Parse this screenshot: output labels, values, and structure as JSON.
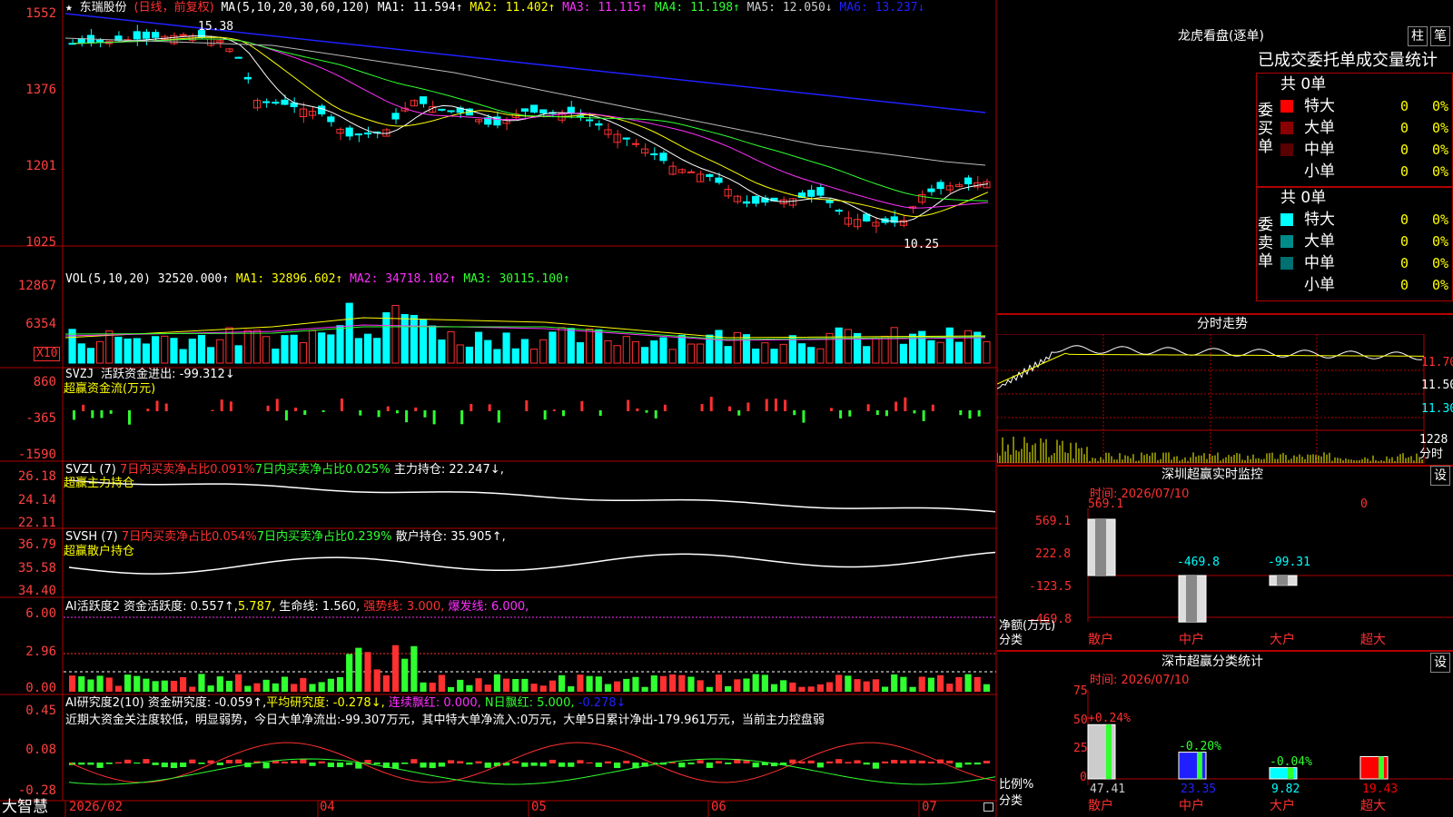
{
  "stock": {
    "star": "★",
    "name": "东瑞股份",
    "mode": "(日线，前复权)",
    "ma_label": "MA(5,10,20,30,60,120)",
    "ma_values": [
      {
        "label": "MA1:",
        "value": "11.594↑",
        "color": "#ffffff"
      },
      {
        "label": "MA2:",
        "value": "11.402↑",
        "color": "#ffff00"
      },
      {
        "label": "MA3:",
        "value": "11.115↑",
        "color": "#ff30ff"
      },
      {
        "label": "MA4:",
        "value": "11.198↑",
        "color": "#30ff30"
      },
      {
        "label": "MA5:",
        "value": "12.050↓",
        "color": "#cccccc"
      },
      {
        "label": "MA6:",
        "value": "13.237↓",
        "color": "#2020ff"
      }
    ],
    "high_marker": "15.38",
    "low_marker": "10.25",
    "price_axis": [
      "1552",
      "1376",
      "1201",
      "1025"
    ]
  },
  "vol": {
    "title": "VOL(5,10,20)",
    "value": "32520.000↑",
    "ma": [
      {
        "label": "MA1:",
        "value": "32896.602↑",
        "color": "#ffff00"
      },
      {
        "label": "MA2:",
        "value": "34718.102↑",
        "color": "#ff30ff"
      },
      {
        "label": "MA3:",
        "value": "30115.100↑",
        "color": "#30ff30"
      }
    ],
    "axis": [
      "12867",
      "6354"
    ],
    "unit": "X10"
  },
  "svzj": {
    "title": "SVZJ",
    "line": "活跃资金进出: -99.312↓",
    "sub": "超赢资金流(万元)",
    "axis": [
      "860",
      "-365",
      "-1590"
    ]
  },
  "svzl": {
    "title": "SVZL (7)",
    "t1": "7日内买卖净占比0.091%",
    "t2": "7日内买卖净占比0.025%",
    "t3": "主力持仓: 22.247↓,",
    "sub": "超赢主力持仓",
    "axis": [
      "26.18",
      "24.14",
      "22.11"
    ]
  },
  "svsh": {
    "title": "SVSH (7)",
    "t1": "7日内买卖净占比0.054%",
    "t2": "7日内买卖净占比0.239%",
    "t3": "散户持仓: 35.905↑,",
    "sub": "超赢散户持仓",
    "axis": [
      "36.79",
      "35.58",
      "34.40"
    ]
  },
  "ai1": {
    "title": "AI活跃度2",
    "t1": "资金活跃度: 0.557↑,",
    "t2": "5.787,",
    "t3": "生命线: 1.560,",
    "t4": "强势线: 3.000,",
    "t5": "爆发线: 6.000,",
    "axis": [
      "6.00",
      "2.96",
      "0.00"
    ]
  },
  "ai2": {
    "title": "AI研究度2(10)",
    "t1": "资金研究度: -0.059↑,",
    "t2": "平均研究度: -0.278↓,",
    "t3": "连续飘红: 0.000,",
    "t4": "N日飘红: 5.000,",
    "t5": "-0.278↓",
    "comment": "近期大资金关注度较低，明显弱势，今日大单净流出:-99.307万元，其中特大单净流入:0万元，大单5日累计净出-179.961万元，当前主力控盘弱",
    "axis": [
      "0.45",
      "0.08",
      "-0.28"
    ]
  },
  "dates": [
    "2026/02",
    "04",
    "05",
    "06",
    "07"
  ],
  "brand": "大智慧",
  "lhb": {
    "title": "龙虎看盘(逐单)",
    "btn1": "柱",
    "btn2": "笔",
    "stat_title": "已成交委托单成交量统计",
    "buy_label": "委买单",
    "sell_label": "委卖单",
    "buy_total": "共 0单",
    "sell_total": "共 0单",
    "buy_rows": [
      {
        "name": "特大",
        "v": "0",
        "p": "0%",
        "color": "#ff0000"
      },
      {
        "name": "大单",
        "v": "0",
        "p": "0%",
        "color": "#8b0000"
      },
      {
        "name": "中单",
        "v": "0",
        "p": "0%",
        "color": "#5a0000"
      },
      {
        "name": "小单",
        "v": "0",
        "p": "0%",
        "color": "#000000"
      }
    ],
    "sell_rows": [
      {
        "name": "特大",
        "v": "0",
        "p": "0%",
        "color": "#00ffff"
      },
      {
        "name": "大单",
        "v": "0",
        "p": "0%",
        "color": "#008b8b"
      },
      {
        "name": "中单",
        "v": "0",
        "p": "0%",
        "color": "#007070"
      },
      {
        "name": "小单",
        "v": "0",
        "p": "0%",
        "color": "#000000"
      }
    ]
  },
  "intraday": {
    "title": "分时走势",
    "axis": [
      "11.70",
      "11.50",
      "11.30"
    ],
    "vol_label": "1228",
    "vol_unit": "分时"
  },
  "sz_monitor": {
    "title": "深圳超赢实时监控",
    "set": "设",
    "time": "时间: 2026/07/10",
    "axis": [
      "569.1",
      "222.8",
      "-123.5",
      "-469.8"
    ],
    "ylabel": "净额(万元)",
    "xlabel": "分类",
    "bars": [
      {
        "cat": "散户",
        "v": "569.1",
        "val": 569.1
      },
      {
        "cat": "中户",
        "v": "-469.8",
        "val": -469.8
      },
      {
        "cat": "大户",
        "v": "-99.31",
        "val": -99.31
      },
      {
        "cat": "超大",
        "v": "0",
        "val": 0
      }
    ]
  },
  "sz_class": {
    "title": "深市超赢分类统计",
    "set": "设",
    "time": "时间: 2026/07/10",
    "axis": [
      "75",
      "50",
      "25",
      "0"
    ],
    "ylabel": "比例%",
    "xlabel": "分类",
    "bars": [
      {
        "cat": "散户",
        "pct": "47.41",
        "chg": "+0.24%",
        "val": 47.41,
        "color": "#cccccc",
        "chg_color": "#ff3030"
      },
      {
        "cat": "中户",
        "pct": "23.35",
        "chg": "-0.20%",
        "val": 23.35,
        "color": "#2020ff",
        "chg_color": "#30ff30"
      },
      {
        "cat": "大户",
        "pct": "9.82",
        "chg": "-0.04%",
        "val": 9.82,
        "color": "#00ffff",
        "chg_color": "#30ff30"
      },
      {
        "cat": "超大",
        "pct": "19.43",
        "chg": "",
        "val": 19.43,
        "color": "#ff0000",
        "chg_color": "#ff3030"
      }
    ]
  },
  "chart_data": {
    "type": "candlestick",
    "title": "东瑞股份 (日线，前复权)",
    "x": [
      "2026/02",
      "04",
      "05",
      "06",
      "07"
    ],
    "y_ticks": [
      1552,
      1376,
      1201,
      1025
    ],
    "high": 15.38,
    "low": 10.25,
    "series": [
      {
        "name": "MA1",
        "last": 11.594
      },
      {
        "name": "MA2",
        "last": 11.402
      },
      {
        "name": "MA3",
        "last": 11.115
      },
      {
        "name": "MA4",
        "last": 11.198
      },
      {
        "name": "MA5",
        "last": 12.05
      },
      {
        "name": "MA6",
        "last": 13.237
      }
    ]
  }
}
